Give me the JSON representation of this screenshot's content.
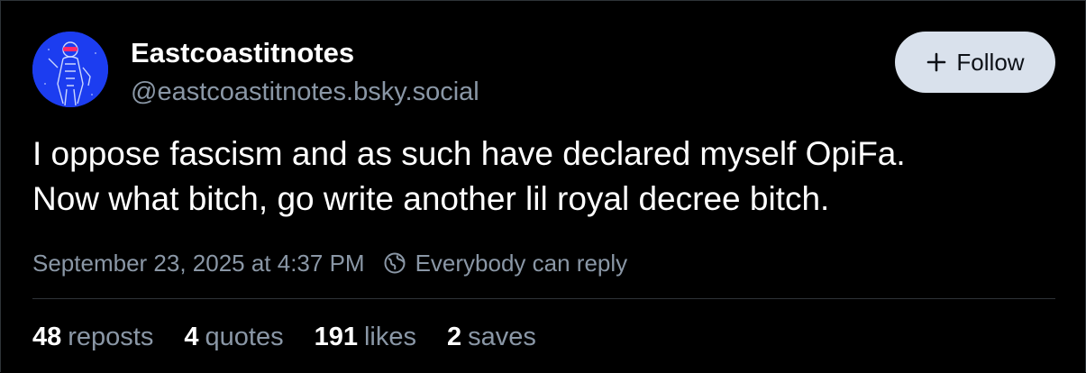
{
  "author": {
    "display_name": "Eastcoastitnotes",
    "handle": "@eastcoastitnotes.bsky.social",
    "avatar_icon": "avatar-figure-icon"
  },
  "follow_button": {
    "label": "Follow",
    "icon": "plus-icon"
  },
  "post": {
    "lines": [
      "I oppose fascism and as such have declared myself OpiFa.",
      "Now what bitch, go write another lil royal decree bitch."
    ],
    "timestamp": "September 23, 2025 at 4:37 PM",
    "reply_setting": "Everybody can reply",
    "reply_icon": "globe-icon"
  },
  "stats": {
    "reposts": {
      "count": "48",
      "label": "reposts"
    },
    "quotes": {
      "count": "4",
      "label": "quotes"
    },
    "likes": {
      "count": "191",
      "label": "likes"
    },
    "saves": {
      "count": "2",
      "label": "saves"
    }
  },
  "colors": {
    "background": "#000000",
    "text_primary": "#ffffff",
    "text_secondary": "#8a97a6",
    "button_bg": "#d9e1ec",
    "avatar_bg": "#1c3df0",
    "divider": "#2e3338"
  }
}
